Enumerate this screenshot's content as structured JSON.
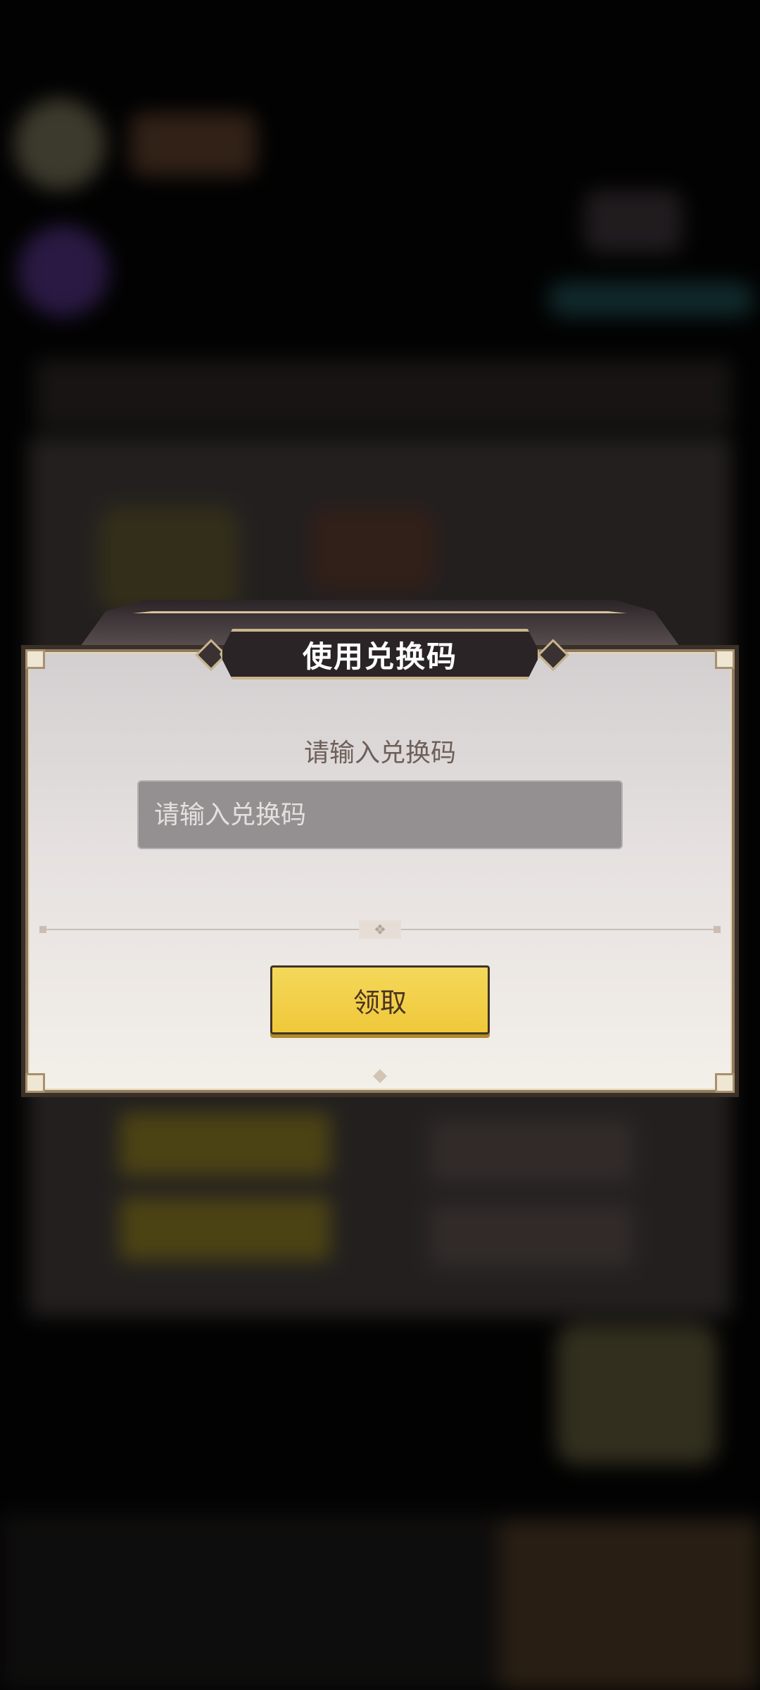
{
  "dialog": {
    "title": "使用兑换码",
    "prompt": "请输入兑换码",
    "input": {
      "value": "",
      "placeholder": "请输入兑换码"
    },
    "claim_button": "领取"
  },
  "colors": {
    "button_fill": "#f2d04a",
    "title_plate": "#2b2426",
    "dialog_frame": "#8f7b62",
    "input_fill": "#949092"
  }
}
